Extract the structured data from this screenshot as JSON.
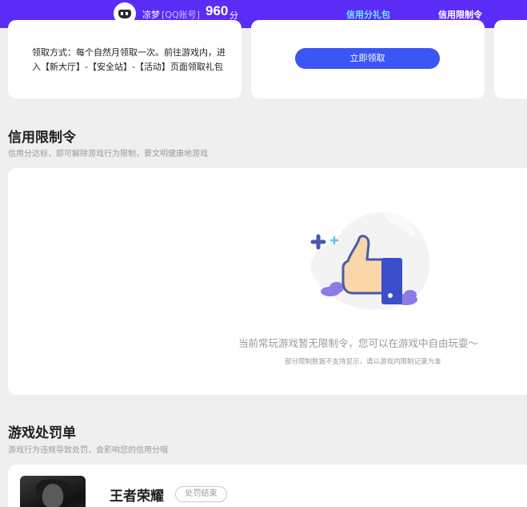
{
  "topbar": {
    "username": "凉梦",
    "account_label": "[QQ账号]",
    "score": "960",
    "score_unit": "分",
    "tabs": [
      {
        "label": "信用分礼包",
        "active": true
      },
      {
        "label": "信用限制令",
        "active": false
      }
    ],
    "accent_color": "#5b2cf6",
    "active_tab_color": "#6fe7ff"
  },
  "gift_cards": {
    "claim_method": "领取方式：每个自然月领取一次。前往游戏内，进入【新大厅】-【安全站】-【活动】页面领取礼包",
    "claim_button": "立即领取",
    "button_color": "#3b55f6"
  },
  "restriction": {
    "title": "信用限制令",
    "subtitle": "信用分达标，即可解除游戏行为限制，要文明健康地游戏",
    "empty_main": "当前常玩游戏暂无限制令，您可以在游戏中自由玩耍～",
    "empty_sub": "部分限制数据不支持显示，请以游戏内限制记录为准",
    "illustration_icon": "thumbs-up-icon"
  },
  "penalty": {
    "title": "游戏处罚单",
    "subtitle": "游戏行为违规导致处罚，会影响您的信用分哦",
    "items": [
      {
        "game_name": "王者荣耀",
        "status": "处罚结束"
      }
    ]
  }
}
